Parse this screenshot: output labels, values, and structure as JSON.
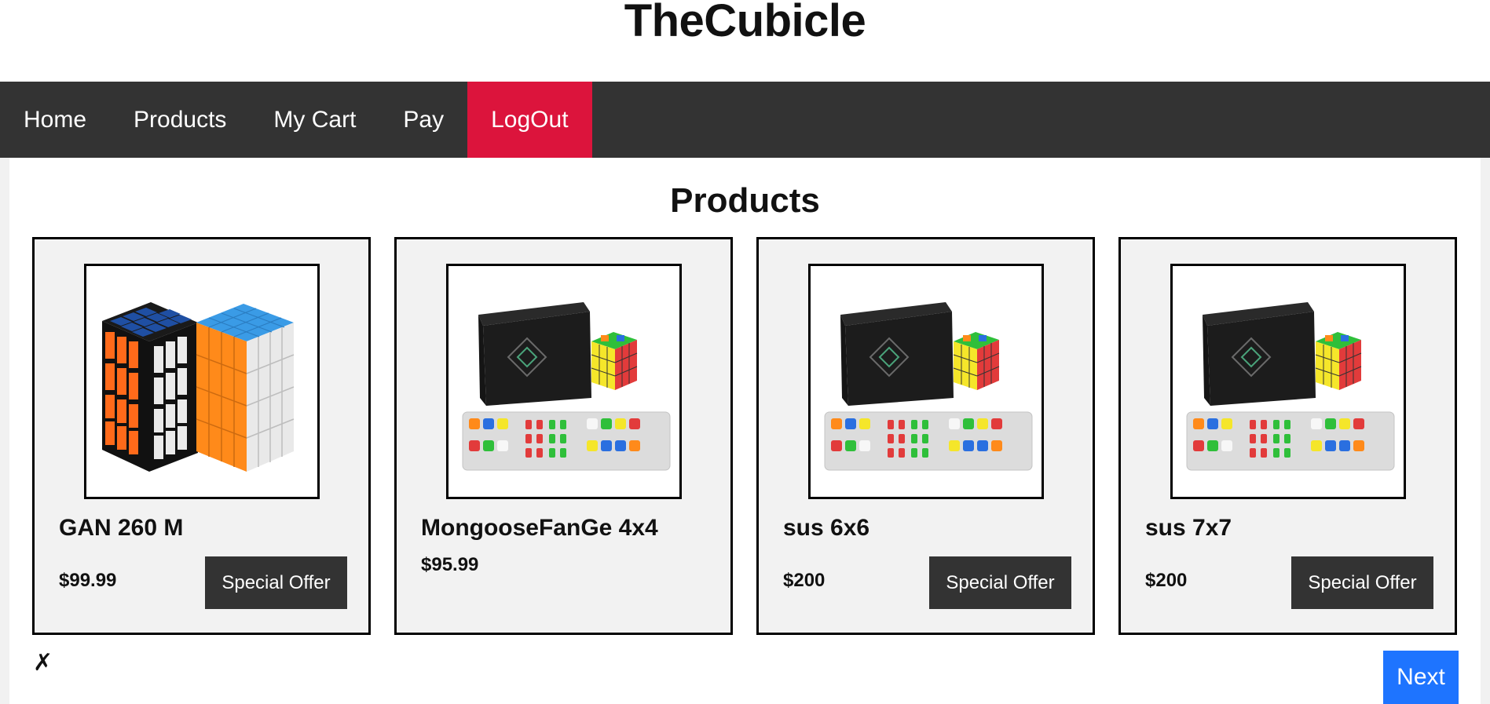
{
  "site": {
    "title": "TheCubicle"
  },
  "nav": {
    "items": [
      {
        "label": "Home"
      },
      {
        "label": "Products"
      },
      {
        "label": "My Cart"
      },
      {
        "label": "Pay"
      },
      {
        "label": "LogOut"
      }
    ],
    "active_color": "#dc143c",
    "bar_color": "#333333"
  },
  "main": {
    "title": "Products",
    "products": [
      {
        "name": "GAN 260 M",
        "price": "$99.99",
        "offer_label": "Special Offer",
        "image": "two-4x4-cubes"
      },
      {
        "name": "MongooseFanGe 4x4",
        "price": "$95.99",
        "offer_label": "",
        "image": "cube-box-set"
      },
      {
        "name": "sus 6x6",
        "price": "$200",
        "offer_label": "Special Offer",
        "image": "cube-box-set"
      },
      {
        "name": "sus 7x7",
        "price": "$200",
        "offer_label": "Special Offer",
        "image": "cube-box-set"
      }
    ],
    "close_symbol": "✗",
    "next_label": "Next",
    "next_color": "#1e74ff"
  }
}
